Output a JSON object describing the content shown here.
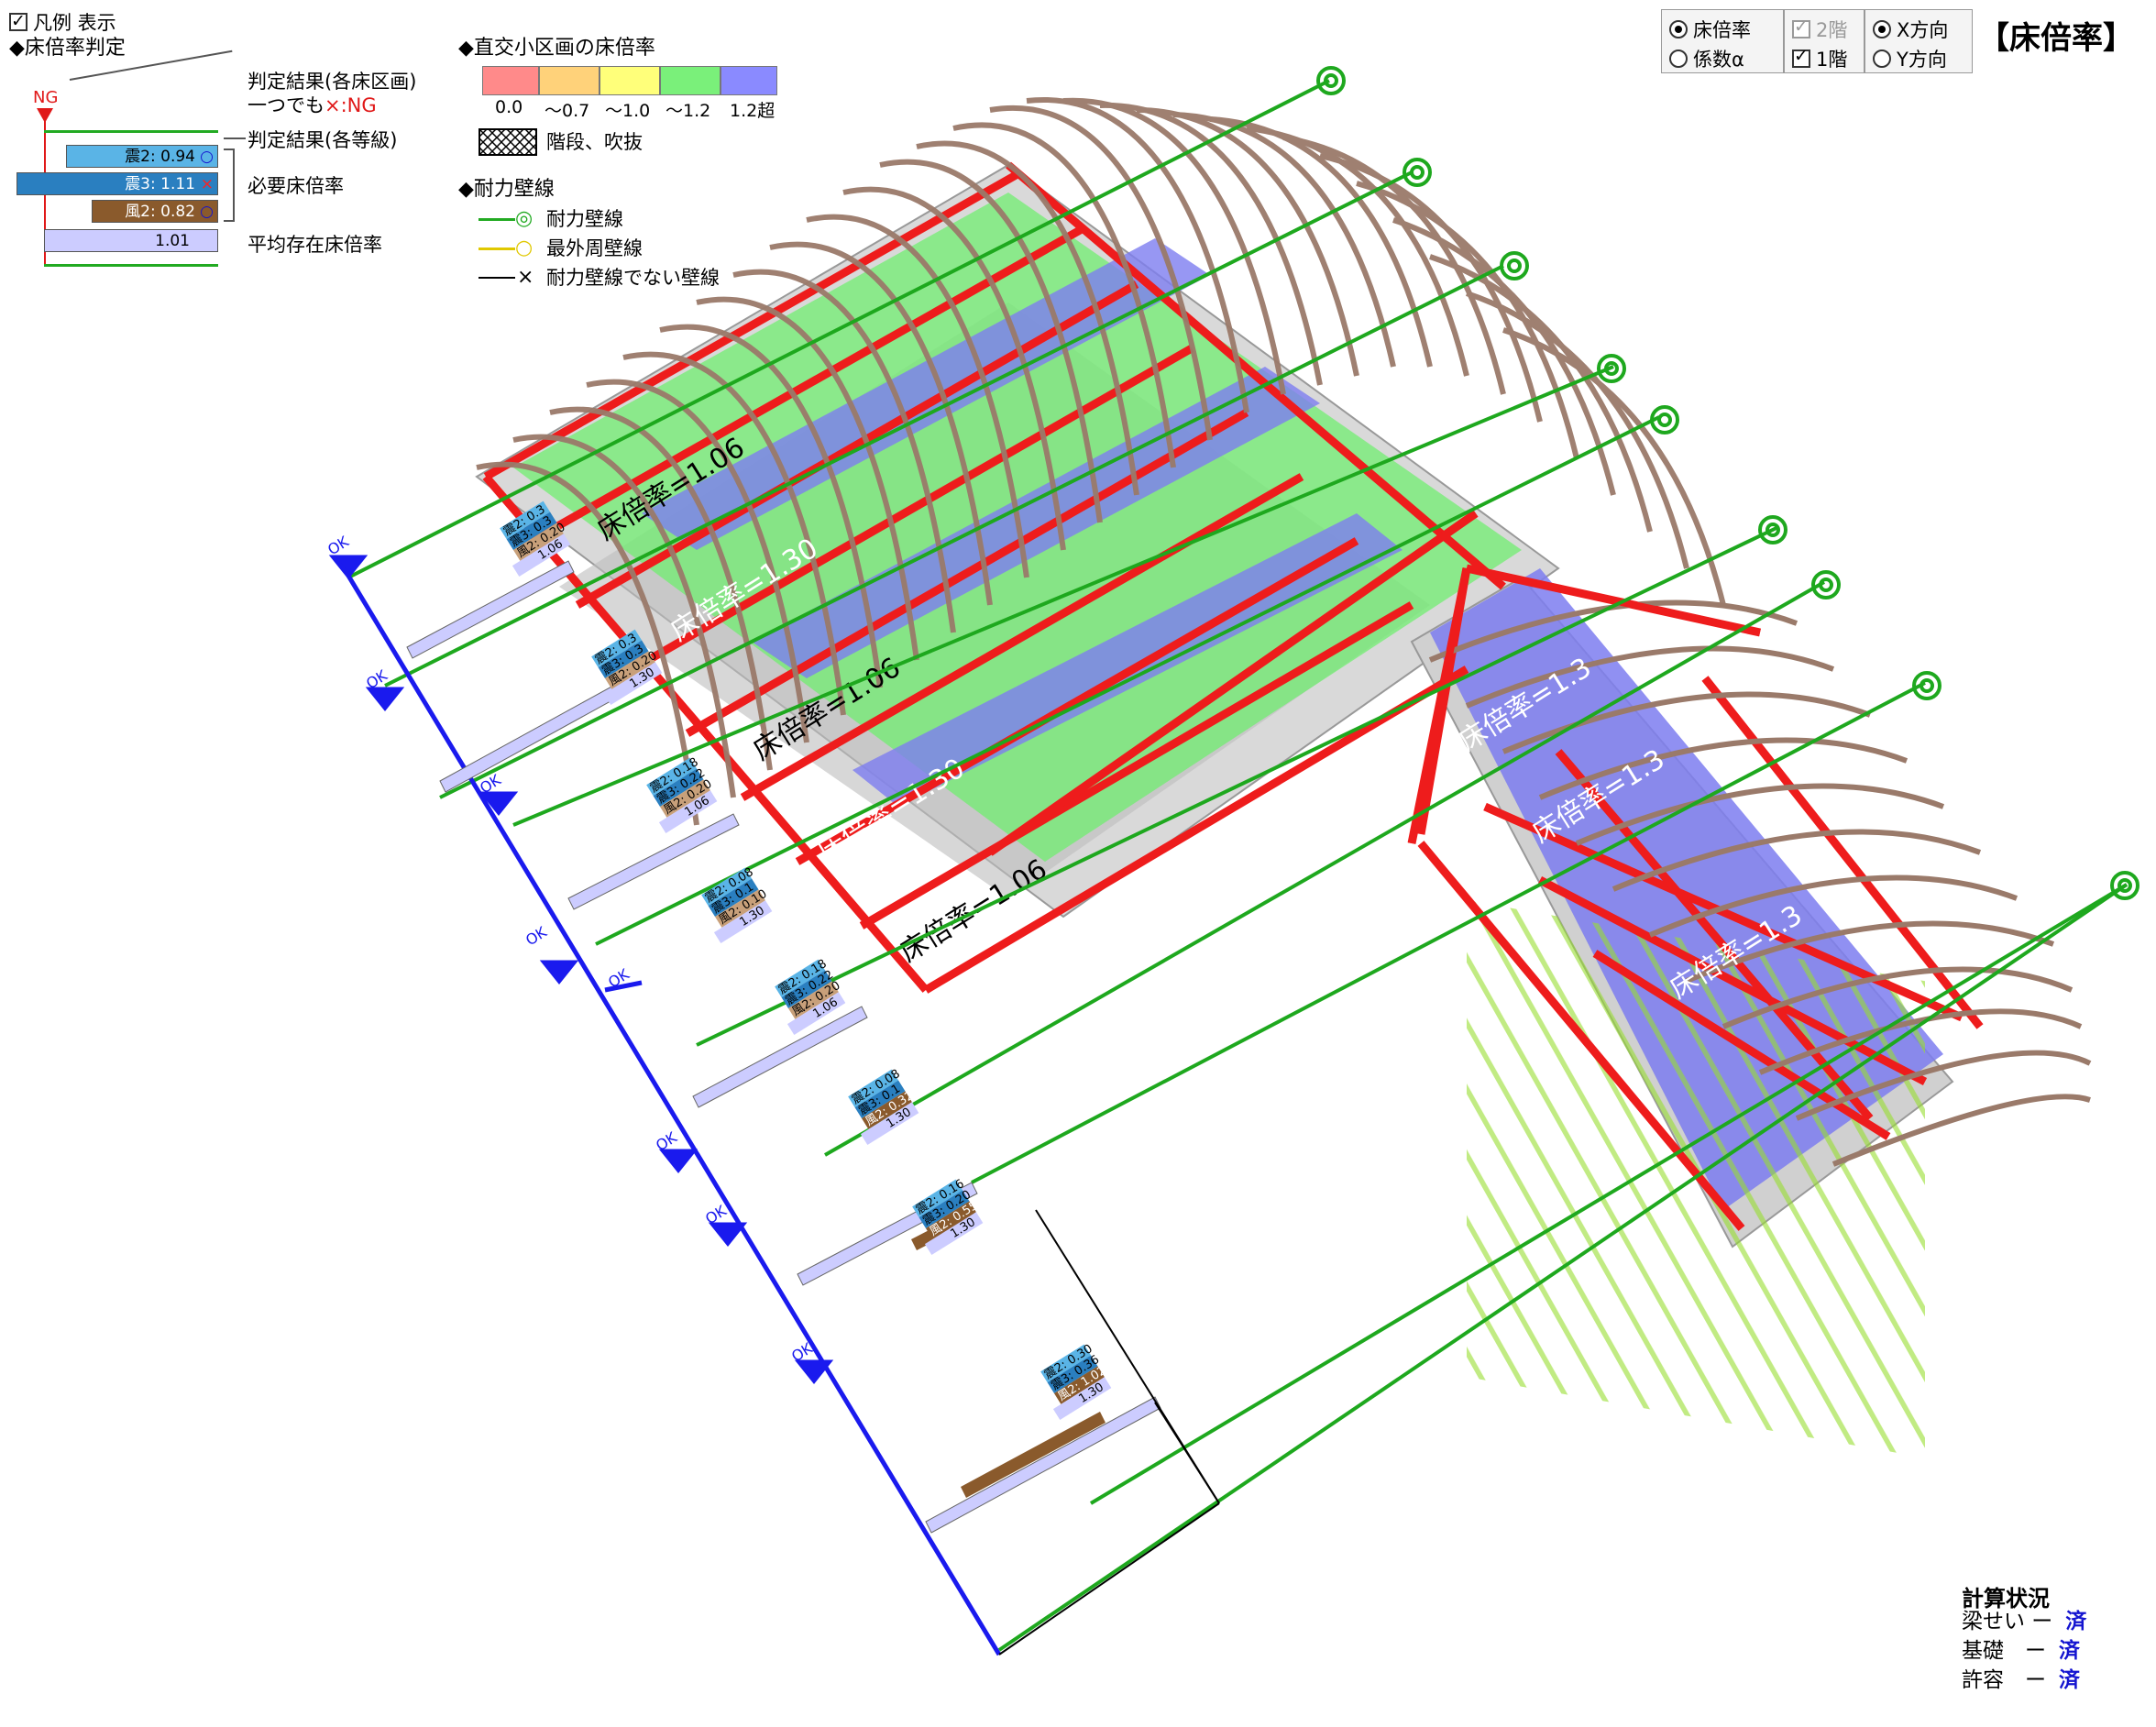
{
  "legend": {
    "show_checkbox_label": "凡例 表示",
    "show_checked": true,
    "judgment_header": "◆床倍率判定",
    "ng_marker": "NG",
    "result_each_section_line1": "判定結果(各床区画)",
    "result_each_section_line2_prefix": "一つでも",
    "result_each_section_line2_mark": "×",
    "result_each_section_line2_suffix": ":NG",
    "result_each_grade": "判定結果(各等級)",
    "required_floor_ratio": "必要床倍率",
    "average_existing_floor_ratio": "平均存在床倍率",
    "sample_bars": [
      {
        "label": "震2: 0.94",
        "mark": "○",
        "color": "#5ab4e6"
      },
      {
        "label": "震3: 1.11",
        "mark": "×",
        "color": "#2a7fc0"
      },
      {
        "label": "風2: 0.82",
        "mark": "○",
        "color": "#8a5a2c"
      }
    ],
    "sample_average": "1.01",
    "color_scale_header": "◆直交小区画の床倍率",
    "color_scale": [
      {
        "label": "0.0",
        "color": "#ff8a8a"
      },
      {
        "label": "〜0.7",
        "color": "#ffd27a"
      },
      {
        "label": "〜1.0",
        "color": "#ffff7a"
      },
      {
        "label": "〜1.2",
        "color": "#7af07a"
      },
      {
        "label": "1.2超",
        "color": "#8a8aff"
      }
    ],
    "hatch_label": "階段、吹抜",
    "wall_line_header": "◆耐力壁線",
    "wall_lines": [
      {
        "symbol": "◎",
        "label": "耐力壁線",
        "color": "#22aa22"
      },
      {
        "symbol": "○",
        "label": "最外周壁線",
        "color": "#e0c800"
      },
      {
        "symbol": "×",
        "label": "耐力壁線でない壁線",
        "color": "#000000"
      }
    ]
  },
  "controls": {
    "group_mode": [
      {
        "label": "床倍率",
        "selected": true
      },
      {
        "label": "係数α",
        "selected": false
      }
    ],
    "group_floor": [
      {
        "label": "2階",
        "checked": true,
        "disabled": true
      },
      {
        "label": "1階",
        "checked": true,
        "disabled": false
      }
    ],
    "group_direction": [
      {
        "label": "X方向",
        "selected": true
      },
      {
        "label": "Y方向",
        "selected": false
      }
    ],
    "view_title": "【床倍率】"
  },
  "status": {
    "header": "計算状況",
    "rows": [
      {
        "label": "梁せい ー",
        "value": "済"
      },
      {
        "label": "基礎　ー",
        "value": "済"
      },
      {
        "label": "許容　ー",
        "value": "済"
      }
    ]
  },
  "model": {
    "floor_labels": [
      "床倍率=1.06",
      "床倍率=1.30",
      "床倍率=1.06",
      "床倍率=1.30",
      "床倍率=1.06",
      "床倍率=1.3",
      "床倍率=1.3",
      "床倍率=1.3"
    ],
    "ok_marker": "OK",
    "wall_line_panels": [
      {
        "rows": [
          "震2: 0.3",
          "震3: 0.3",
          "風2: 0.20"
        ],
        "avg": "1.06"
      },
      {
        "rows": [
          "震2: 0.3",
          "震3: 0.3",
          "風2: 0.20"
        ],
        "avg": "1.30"
      },
      {
        "rows": [
          "震2: 0.18",
          "震3: 0.22",
          "風2: 0.20"
        ],
        "avg": "1.06"
      },
      {
        "rows": [
          "震2: 0.08",
          "震3: 0.1",
          "風2: 0.10"
        ],
        "avg": "1.30"
      },
      {
        "rows": [
          "震2: 0.18",
          "震3: 0.22",
          "風2: 0.20"
        ],
        "avg": "1.06"
      },
      {
        "rows": [
          "震2: 0.08",
          "震3: 0.1",
          "風2: 0.32"
        ],
        "avg": "1.30"
      },
      {
        "rows": [
          "震2: 0.16",
          "震3: 0.20",
          "風2: 0.55"
        ],
        "avg": "1.30"
      },
      {
        "rows": [
          "震2: 0.30",
          "震3: 0.36",
          "風2: 1.02"
        ],
        "avg": "1.30"
      }
    ]
  }
}
